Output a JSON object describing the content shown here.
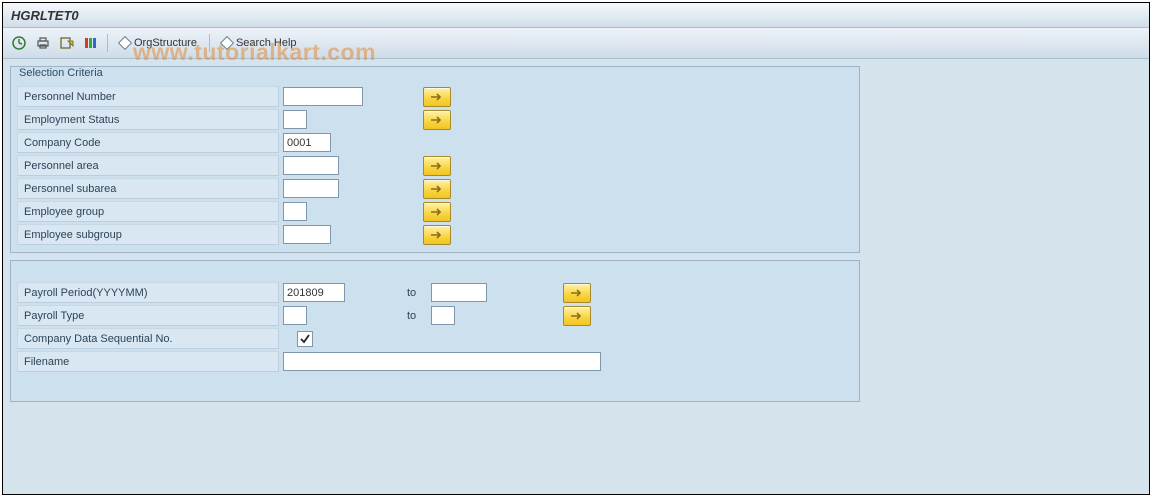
{
  "header": {
    "title": "HGRLTET0"
  },
  "toolbar": {
    "orgstructure_label": "OrgStructure",
    "searchhelp_label": "Search Help"
  },
  "watermark": "www.tutorialkart.com",
  "sel_criteria": {
    "legend": "Selection Criteria",
    "rows": {
      "pernr": {
        "label": "Personnel Number",
        "value": "",
        "has_mult": true,
        "width": "w80"
      },
      "empstat": {
        "label": "Employment Status",
        "value": "",
        "has_mult": true,
        "width": "w24"
      },
      "bukrs": {
        "label": "Company Code",
        "value": "0001",
        "has_mult": false,
        "width": "w48"
      },
      "persa": {
        "label": "Personnel area",
        "value": "",
        "has_mult": true,
        "width": "w56"
      },
      "btrtl": {
        "label": "Personnel subarea",
        "value": "",
        "has_mult": true,
        "width": "w56"
      },
      "persg": {
        "label": "Employee group",
        "value": "",
        "has_mult": true,
        "width": "w24"
      },
      "persk": {
        "label": "Employee subgroup",
        "value": "",
        "has_mult": true,
        "width": "w48"
      }
    }
  },
  "params": {
    "rows": {
      "period": {
        "label": "Payroll Period(YYYYMM)",
        "from": "201809",
        "to": "",
        "to_label": "to",
        "has_mult": true
      },
      "ptype": {
        "label": "Payroll Type",
        "from": "",
        "to": "",
        "to_label": "to",
        "has_mult": true
      },
      "seqno": {
        "label": "Company Data Sequential No.",
        "checked": true
      },
      "fname": {
        "label": "Filename",
        "value": ""
      }
    }
  }
}
